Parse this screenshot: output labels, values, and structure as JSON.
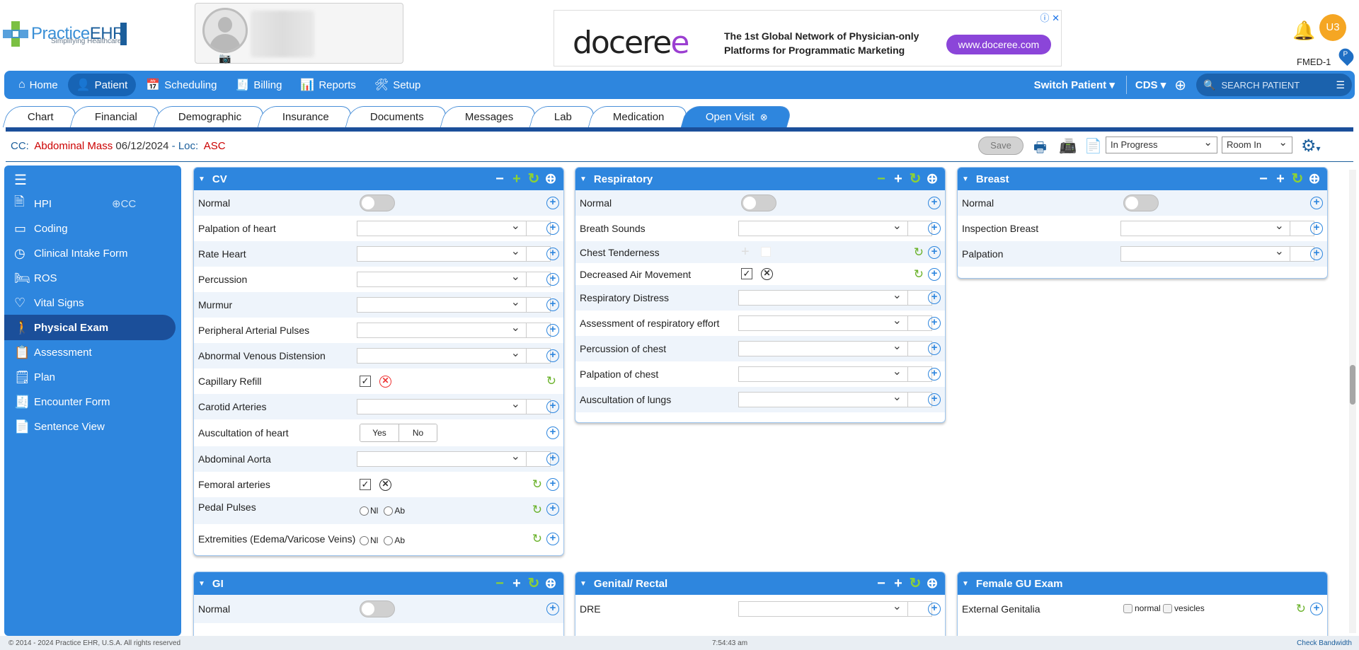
{
  "brand": {
    "name_a": "Practice",
    "name_b": "EHR",
    "tagline": "Simplifying Healthcare"
  },
  "ad": {
    "logo_a": "docere",
    "logo_b": "e",
    "line1": "The 1st Global Network of Physician-only",
    "line2": "Platforms for Programmatic Marketing",
    "button": "www.doceree.com"
  },
  "user": {
    "initials": "U3",
    "facility": "FMED-1",
    "pin": "P"
  },
  "nav": {
    "items": [
      {
        "label": "Home",
        "icon": "home-icon"
      },
      {
        "label": "Patient",
        "icon": "person-icon"
      },
      {
        "label": "Scheduling",
        "icon": "calendar-icon"
      },
      {
        "label": "Billing",
        "icon": "billing-icon"
      },
      {
        "label": "Reports",
        "icon": "reports-icon"
      },
      {
        "label": "Setup",
        "icon": "setup-icon"
      }
    ],
    "switch_patient": "Switch Patient",
    "cds": "CDS",
    "search_placeholder": "SEARCH PATIENT"
  },
  "tabs": [
    "Chart",
    "Financial",
    "Demographic",
    "Insurance",
    "Documents",
    "Messages",
    "Lab",
    "Medication",
    "Open Visit"
  ],
  "cc": {
    "label": "CC:",
    "complaint": "Abdominal Mass",
    "date": "06/12/2024",
    "loc_label": "- Loc:",
    "loc": "ASC"
  },
  "toolbar": {
    "save": "Save",
    "status": "In Progress",
    "room": "Room In"
  },
  "sidebar": {
    "add_cc": "CC",
    "items": [
      {
        "label": "HPI",
        "icon": "document-icon"
      },
      {
        "label": "Coding",
        "icon": "coding-icon"
      },
      {
        "label": "Clinical Intake Form",
        "icon": "clock-icon"
      },
      {
        "label": "ROS",
        "icon": "bed-icon"
      },
      {
        "label": "Vital Signs",
        "icon": "heart-icon"
      },
      {
        "label": "Physical Exam",
        "icon": "body-icon"
      },
      {
        "label": "Assessment",
        "icon": "clipboard-icon"
      },
      {
        "label": "Plan",
        "icon": "plan-icon"
      },
      {
        "label": "Encounter Form",
        "icon": "dollar-doc-icon"
      },
      {
        "label": "Sentence View",
        "icon": "text-doc-icon"
      }
    ]
  },
  "panels": {
    "cv": {
      "title": "CV",
      "rows": [
        "Normal",
        "Palpation of heart",
        "Rate Heart",
        "Percussion",
        "Murmur",
        "Peripheral Arterial Pulses",
        "Abnormal Venous Distension",
        "Capillary Refill",
        "Carotid Arteries",
        "Auscultation of heart",
        "Abdominal Aorta",
        "Femoral arteries",
        "Pedal Pulses",
        "Extremities (Edema/Varicose Veins)"
      ],
      "yes": "Yes",
      "no": "No",
      "nl": "Nl",
      "ab": "Ab"
    },
    "resp": {
      "title": "Respiratory",
      "rows": [
        "Normal",
        "Breath Sounds",
        "Chest Tenderness",
        "Decreased Air Movement",
        "Respiratory Distress",
        "Assessment of respiratory effort",
        "Percussion of chest",
        "Palpation of chest",
        "Auscultation of lungs"
      ]
    },
    "breast": {
      "title": "Breast",
      "rows": [
        "Normal",
        "Inspection Breast",
        "Palpation"
      ]
    },
    "gi": {
      "title": "GI",
      "rows": [
        "Normal"
      ]
    },
    "genital": {
      "title": "Genital/ Rectal",
      "rows": [
        "DRE"
      ]
    },
    "female": {
      "title": "Female GU Exam",
      "rows": [
        "External Genitalia"
      ],
      "opt1": "normal",
      "opt2": "vesicles"
    }
  },
  "footer": {
    "copyright": "© 2014 - 2024 Practice EHR, U.S.A. All rights reserved",
    "time": "7:54:43 am",
    "bandwidth": "Check Bandwidth"
  }
}
